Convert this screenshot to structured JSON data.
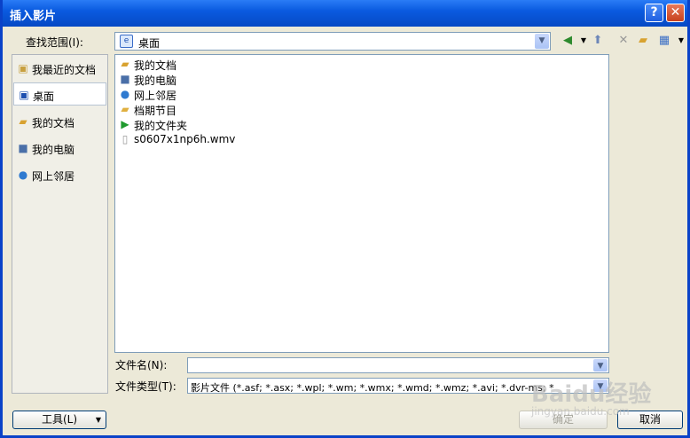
{
  "title": "插入影片",
  "lookin": {
    "label": "查找范围(I):",
    "value": "桌面"
  },
  "places": [
    {
      "label": "我最近的文档",
      "icon": "recent-icon"
    },
    {
      "label": "桌面",
      "icon": "desktop-icon",
      "selected": true
    },
    {
      "label": "我的文档",
      "icon": "my-documents-icon"
    },
    {
      "label": "我的电脑",
      "icon": "my-computer-icon"
    },
    {
      "label": "网上邻居",
      "icon": "network-icon"
    }
  ],
  "files": [
    {
      "name": "我的文档",
      "icon": "my-documents-icon"
    },
    {
      "name": "我的电脑",
      "icon": "my-computer-icon"
    },
    {
      "name": "网上邻居",
      "icon": "network-icon"
    },
    {
      "name": "档期节目",
      "icon": "folder-icon"
    },
    {
      "name": "我的文件夹",
      "icon": "play-icon"
    },
    {
      "name": "s0607x1np6h.wmv",
      "icon": "wmv-file-icon"
    }
  ],
  "filename": {
    "label": "文件名(N):",
    "value": ""
  },
  "filetype": {
    "label": "文件类型(T):",
    "value": "影片文件 (*.asf; *.asx; *.wpl; *.wm; *.wmx; *.wmd; *.wmz; *.avi; *.dvr-ms; *"
  },
  "buttons": {
    "tools": "工具(L)",
    "ok": "确定",
    "cancel": "取消"
  },
  "watermark": {
    "brand": "Baidu经验",
    "url": "jingyan.baidu.com"
  }
}
